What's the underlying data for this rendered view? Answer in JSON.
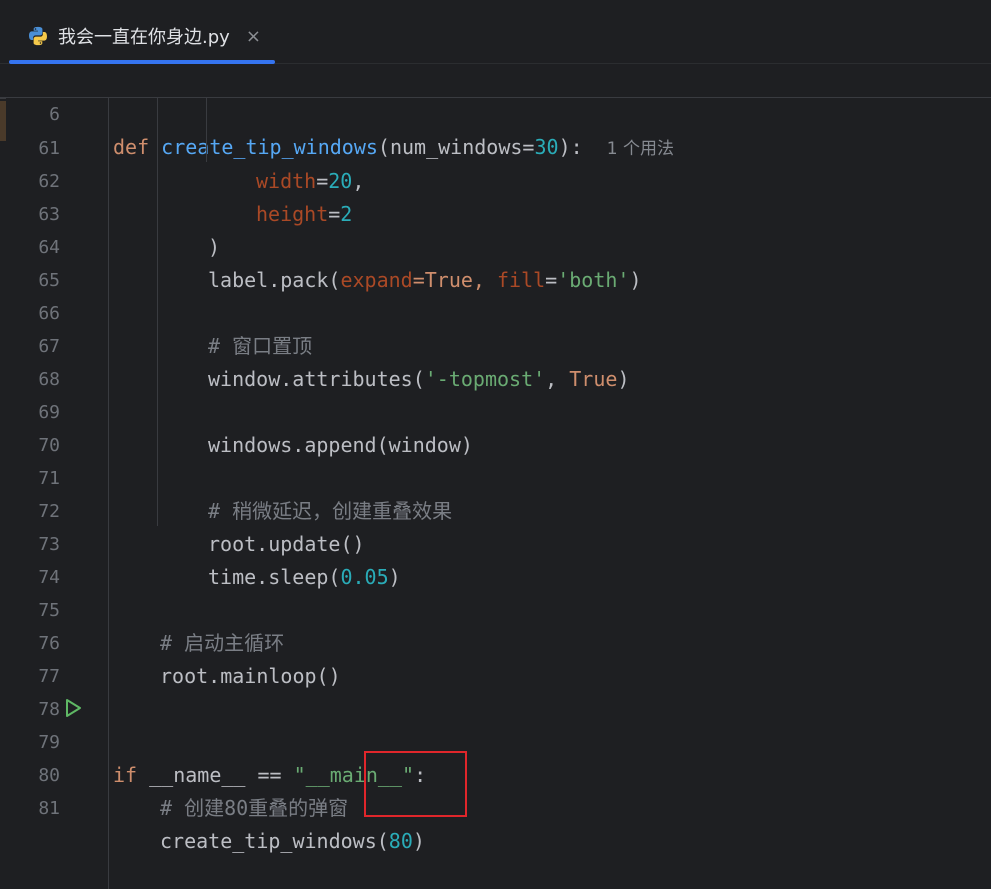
{
  "tab": {
    "title": "我会一直在你身边.py",
    "close": "×",
    "icon": "python-icon"
  },
  "sticky": {
    "line_number": "6",
    "kw": "def",
    "fn": "create_tip_windows",
    "p1": "(num_windows=",
    "num": "30",
    "p2": "):",
    "usage": "1 个用法"
  },
  "lines": [
    {
      "n": "61"
    },
    {
      "n": "62"
    },
    {
      "n": "63"
    },
    {
      "n": "64"
    },
    {
      "n": "65"
    },
    {
      "n": "66"
    },
    {
      "n": "67"
    },
    {
      "n": "68"
    },
    {
      "n": "69"
    },
    {
      "n": "70"
    },
    {
      "n": "71"
    },
    {
      "n": "72"
    },
    {
      "n": "73"
    },
    {
      "n": "74"
    },
    {
      "n": "75"
    },
    {
      "n": "76"
    },
    {
      "n": "77"
    },
    {
      "n": "78"
    },
    {
      "n": "79"
    },
    {
      "n": "80"
    },
    {
      "n": "81"
    }
  ],
  "code": {
    "l61": {
      "a": "width",
      "b": "=",
      "c": "20",
      "d": ","
    },
    "l62": {
      "a": "height",
      "b": "=",
      "c": "2"
    },
    "l63": {
      "a": ")"
    },
    "l64": {
      "a": "label.pack(",
      "b": "expand",
      "c": "=True, ",
      "d": "fill",
      "e": "=",
      "f": "'both'",
      "g": ")"
    },
    "l66": {
      "a": "# 窗口置顶"
    },
    "l67": {
      "a": "window.attributes(",
      "b": "'-topmost'",
      "c": ", ",
      "d": "True",
      "e": ")"
    },
    "l69": {
      "a": "windows.append(window)"
    },
    "l71": {
      "a": "# 稍微延迟，创建重叠效果"
    },
    "l72": {
      "a": "root.update()"
    },
    "l73": {
      "a": "time.sleep(",
      "b": "0.05",
      "c": ")"
    },
    "l75": {
      "a": "# 启动主循环"
    },
    "l76": {
      "a": "root.mainloop()"
    },
    "l79": {
      "a": "if",
      "b": " __name__ == ",
      "c": "\"__main__\"",
      "d": ":"
    },
    "l80": {
      "a": "# 创建80重叠的弹窗"
    },
    "l81": {
      "a": "create_tip_windows(",
      "b": "80",
      "c": ")"
    }
  },
  "colors": {
    "background": "#1e1f22",
    "keyword": "#cf8e6d",
    "function": "#56a8f5",
    "number": "#2aacb8",
    "string": "#6aab73",
    "parameter": "#aa4926",
    "comment": "#7a7e85",
    "tab_accent": "#3574f0",
    "highlight_box": "#e0262b",
    "run_icon": "#5fb865"
  }
}
